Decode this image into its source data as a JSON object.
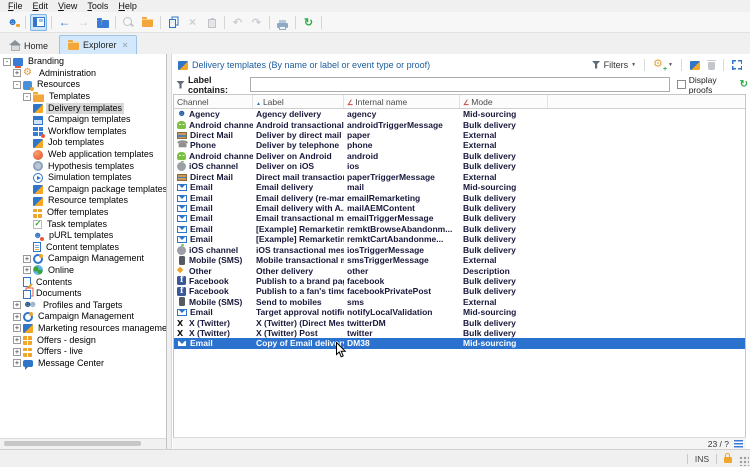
{
  "window": {
    "menu": [
      "File",
      "Edit",
      "View",
      "Tools",
      "Help"
    ]
  },
  "toolbar": {
    "items": [
      {
        "type": "btn",
        "icon": "connect-icon",
        "name": "connect-button",
        "enabled": true
      },
      {
        "type": "sep"
      },
      {
        "type": "btn",
        "icon": "panel-icon",
        "name": "home-page-button",
        "enabled": true,
        "active": true
      },
      {
        "type": "sep"
      },
      {
        "type": "btn",
        "icon": "back-icon",
        "name": "back-button",
        "enabled": true
      },
      {
        "type": "btn",
        "icon": "forward-icon",
        "name": "forward-button",
        "enabled": false
      },
      {
        "type": "btn",
        "icon": "folder-up-icon",
        "name": "parent-folder-button",
        "enabled": true
      },
      {
        "type": "sep"
      },
      {
        "type": "btn",
        "icon": "preview-icon",
        "name": "preview-button",
        "enabled": false
      },
      {
        "type": "btn",
        "icon": "folder-icon",
        "name": "open-folder-button",
        "enabled": true
      },
      {
        "type": "sep"
      },
      {
        "type": "btn",
        "icon": "copy-icon",
        "name": "copy-button",
        "enabled": true
      },
      {
        "type": "btn",
        "icon": "cut-icon",
        "name": "cut-button",
        "enabled": false
      },
      {
        "type": "btn",
        "icon": "paste-icon",
        "name": "paste-button",
        "enabled": false
      },
      {
        "type": "sep"
      },
      {
        "type": "btn",
        "icon": "undo-icon",
        "name": "undo-button",
        "enabled": false
      },
      {
        "type": "btn",
        "icon": "redo-icon",
        "name": "redo-button",
        "enabled": false
      },
      {
        "type": "sep"
      },
      {
        "type": "btn",
        "icon": "print-icon",
        "name": "print-button",
        "enabled": true
      },
      {
        "type": "sep"
      },
      {
        "type": "btn",
        "icon": "refresh-icon",
        "name": "refresh-button",
        "enabled": true
      },
      {
        "type": "sep"
      }
    ]
  },
  "tabs": [
    {
      "label": "Home",
      "icon": "home-icon",
      "active": false,
      "closable": false
    },
    {
      "label": "Explorer",
      "icon": "folder-icon",
      "active": true,
      "closable": true
    }
  ],
  "tree": {
    "items": [
      {
        "level": 0,
        "exp": "-",
        "icon": "branding-icon",
        "label": "Branding",
        "selected": false
      },
      {
        "level": 1,
        "exp": "+",
        "icon": "wrench-icon",
        "label": "Administration",
        "selected": false
      },
      {
        "level": 1,
        "exp": "-",
        "icon": "resources-icon",
        "label": "Resources",
        "selected": false
      },
      {
        "level": 2,
        "exp": "-",
        "icon": "folder-icon",
        "label": "Templates",
        "selected": false
      },
      {
        "level": 3,
        "exp": "",
        "icon": "delivery-template-icon",
        "label": "Delivery templates",
        "selected": true
      },
      {
        "level": 3,
        "exp": "",
        "icon": "campaign-template-icon",
        "label": "Campaign templates",
        "selected": false
      },
      {
        "level": 3,
        "exp": "",
        "icon": "workflow-icon",
        "label": "Workflow templates",
        "selected": false
      },
      {
        "level": 3,
        "exp": "",
        "icon": "job-template-icon",
        "label": "Job templates",
        "selected": false
      },
      {
        "level": 3,
        "exp": "",
        "icon": "webapp-icon",
        "label": "Web application templates",
        "selected": false
      },
      {
        "level": 3,
        "exp": "",
        "icon": "hypothesis-icon",
        "label": "Hypothesis templates",
        "selected": false
      },
      {
        "level": 3,
        "exp": "",
        "icon": "simulation-icon",
        "label": "Simulation templates",
        "selected": false
      },
      {
        "level": 3,
        "exp": "",
        "icon": "package-template-icon",
        "label": "Campaign package templates",
        "selected": false
      },
      {
        "level": 3,
        "exp": "",
        "icon": "resource-template-icon",
        "label": "Resource templates",
        "selected": false
      },
      {
        "level": 3,
        "exp": "",
        "icon": "offer-icon",
        "label": "Offer templates",
        "selected": false
      },
      {
        "level": 3,
        "exp": "",
        "icon": "task-icon",
        "label": "Task templates",
        "selected": false
      },
      {
        "level": 3,
        "exp": "",
        "icon": "purl-icon",
        "label": "pURL templates",
        "selected": false
      },
      {
        "level": 3,
        "exp": "",
        "icon": "content-template-icon",
        "label": "Content templates",
        "selected": false
      },
      {
        "level": 2,
        "exp": "+",
        "icon": "campaign-mgmt-icon",
        "label": "Campaign Management",
        "selected": false
      },
      {
        "level": 2,
        "exp": "+",
        "icon": "online-icon",
        "label": "Online",
        "selected": false
      },
      {
        "level": 2,
        "exp": "",
        "icon": "contents-icon",
        "label": "Contents",
        "selected": false
      },
      {
        "level": 2,
        "exp": "",
        "icon": "documents-icon",
        "label": "Documents",
        "selected": false
      },
      {
        "level": 1,
        "exp": "+",
        "icon": "profiles-icon",
        "label": "Profiles and Targets",
        "selected": false
      },
      {
        "level": 1,
        "exp": "+",
        "icon": "campaign-mgmt-icon",
        "label": "Campaign Management",
        "selected": false
      },
      {
        "level": 1,
        "exp": "+",
        "icon": "mrm-icon",
        "label": "Marketing resources management",
        "selected": false
      },
      {
        "level": 1,
        "exp": "+",
        "icon": "offer-icon",
        "label": "Offers - design",
        "selected": false
      },
      {
        "level": 1,
        "exp": "+",
        "icon": "offer-icon",
        "label": "Offers - live",
        "selected": false
      },
      {
        "level": 1,
        "exp": "+",
        "icon": "message-center-icon",
        "label": "Message Center",
        "selected": false
      }
    ]
  },
  "panel": {
    "title": "Delivery templates (By name or label or event type or proof)",
    "filters_label": "Filters",
    "filter_field_label": "Label contains:",
    "filter_value": "",
    "display_proofs_label": "Display proofs",
    "record_count": "23 / ?"
  },
  "table": {
    "columns": [
      {
        "label": "Channel",
        "sort": ""
      },
      {
        "label": "Label",
        "sort": "asc"
      },
      {
        "label": "Internal name",
        "sort": "mark"
      },
      {
        "label": "Mode",
        "sort": "mark"
      }
    ],
    "rows": [
      {
        "icon": "agency-icon",
        "channel": "Agency",
        "label": "Agency delivery",
        "internal": "agency",
        "mode": "Mid-sourcing",
        "selected": false
      },
      {
        "icon": "android-icon",
        "channel": "Android channel",
        "label": "Android transactional me...",
        "internal": "androidTriggerMessage",
        "mode": "Bulk delivery",
        "selected": false
      },
      {
        "icon": "directmail-icon",
        "channel": "Direct Mail",
        "label": "Deliver by direct mail",
        "internal": "paper",
        "mode": "External",
        "selected": false
      },
      {
        "icon": "phone-icon",
        "channel": "Phone",
        "label": "Deliver by telephone",
        "internal": "phone",
        "mode": "External",
        "selected": false
      },
      {
        "icon": "android-icon",
        "channel": "Android channel",
        "label": "Deliver on Android",
        "internal": "android",
        "mode": "Bulk delivery",
        "selected": false
      },
      {
        "icon": "ios-icon",
        "channel": "iOS channel",
        "label": "Deliver on iOS",
        "internal": "ios",
        "mode": "Bulk delivery",
        "selected": false
      },
      {
        "icon": "directmail-icon",
        "channel": "Direct Mail",
        "label": "Direct mail transactiona...",
        "internal": "paperTriggerMessage",
        "mode": "External",
        "selected": false
      },
      {
        "icon": "email-icon",
        "channel": "Email",
        "label": "Email delivery",
        "internal": "mail",
        "mode": "Mid-sourcing",
        "selected": false
      },
      {
        "icon": "email-icon",
        "channel": "Email",
        "label": "Email delivery (re-marke...",
        "internal": "emailRemarketing",
        "mode": "Bulk delivery",
        "selected": false
      },
      {
        "icon": "email-icon",
        "channel": "Email",
        "label": "Email delivery with A...",
        "internal": "mailAEMContent",
        "mode": "Bulk delivery",
        "selected": false
      },
      {
        "icon": "email-icon",
        "channel": "Email",
        "label": "Email transactional me...",
        "internal": "emailTriggerMessage",
        "mode": "Bulk delivery",
        "selected": false
      },
      {
        "icon": "email-icon",
        "channel": "Email",
        "label": "[Example] Remarketing ...",
        "internal": "remktBrowseAbandonm...",
        "mode": "Bulk delivery",
        "selected": false
      },
      {
        "icon": "email-icon",
        "channel": "Email",
        "label": "[Example] Remarketing...",
        "internal": "remktCartAbandonme...",
        "mode": "Bulk delivery",
        "selected": false
      },
      {
        "icon": "ios-icon",
        "channel": "iOS channel",
        "label": "iOS transactional messa...",
        "internal": "iosTriggerMessage",
        "mode": "Bulk delivery",
        "selected": false
      },
      {
        "icon": "mobile-icon",
        "channel": "Mobile (SMS)",
        "label": "Mobile transactional me...",
        "internal": "smsTriggerMessage",
        "mode": "External",
        "selected": false
      },
      {
        "icon": "other-icon",
        "channel": "Other",
        "label": "Other delivery",
        "internal": "other",
        "mode": "Description",
        "selected": false
      },
      {
        "icon": "facebook-icon",
        "channel": "Facebook",
        "label": "Publish to a brand page",
        "internal": "facebook",
        "mode": "Bulk delivery",
        "selected": false
      },
      {
        "icon": "facebook-icon",
        "channel": "Facebook",
        "label": "Publish to a fan's timel...",
        "internal": "facebookPrivatePost",
        "mode": "Bulk delivery",
        "selected": false
      },
      {
        "icon": "mobile-icon",
        "channel": "Mobile (SMS)",
        "label": "Send to mobiles",
        "internal": "sms",
        "mode": "External",
        "selected": false
      },
      {
        "icon": "email-icon",
        "channel": "Email",
        "label": "Target approval notific...",
        "internal": "notifyLocalValidation",
        "mode": "Mid-sourcing",
        "selected": false
      },
      {
        "icon": "x-icon",
        "channel": "X (Twitter)",
        "label": "X (Twitter) (Direct Mes...",
        "internal": "twitterDM",
        "mode": "Bulk delivery",
        "selected": false
      },
      {
        "icon": "x-icon",
        "channel": "X (Twitter)",
        "label": "X (Twitter) Post",
        "internal": "twitter",
        "mode": "Bulk delivery",
        "selected": false
      },
      {
        "icon": "email-icon",
        "channel": "Email",
        "label": "Copy of Email delivery",
        "internal": "DM38",
        "mode": "Mid-sourcing",
        "selected": true
      }
    ]
  },
  "statusbar": {
    "insert_mode": "INS"
  },
  "colors": {
    "selection_blue": "#2a72ce",
    "title_blue": "#1b5c9e",
    "folder_orange": "#f3a73b",
    "tab_active_bg": "#d3e8fa",
    "sort_mark_red": "#c0504d"
  }
}
